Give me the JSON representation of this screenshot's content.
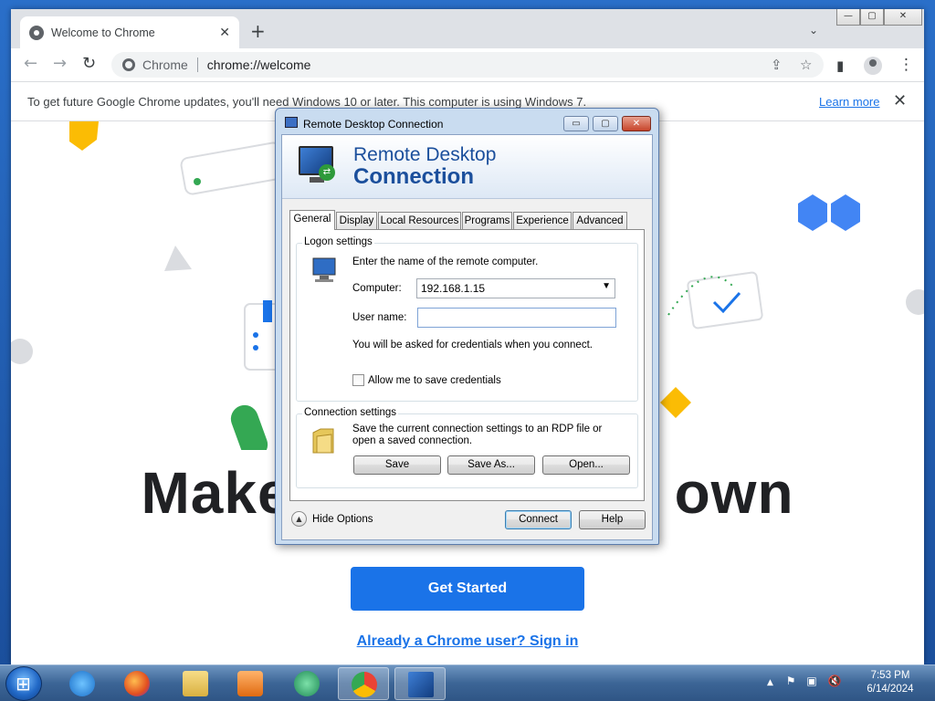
{
  "browser": {
    "tab_title": "Welcome to Chrome",
    "tab_close": "✕",
    "new_tab": "+",
    "tab_search": "⌄",
    "window_controls": [
      "—",
      "▢",
      "✕"
    ],
    "site_label": "Chrome",
    "url": "chrome://welcome",
    "back_icon": "←",
    "forward_icon": "→",
    "reload_icon": "↻",
    "share_icon": "⇪",
    "bookmark_icon": "☆",
    "sidepanel_icon": "▮",
    "menu_icon": "⋮"
  },
  "infobar": {
    "message": "To get future Google Chrome updates, you'll need Windows 10 or later. This computer is using Windows 7.",
    "learn_more": "Learn more",
    "close": "✕"
  },
  "welcome": {
    "headline_left": "Make",
    "headline_right": "own",
    "get_started": "Get Started",
    "sign_in": "Already a Chrome user? Sign in"
  },
  "rdp": {
    "title": "Remote Desktop Connection",
    "banner_line1": "Remote Desktop",
    "banner_line2": "Connection",
    "controls": [
      "▭",
      "▢",
      "✕"
    ],
    "tabs": [
      "General",
      "Display",
      "Local Resources",
      "Programs",
      "Experience",
      "Advanced"
    ],
    "logon_legend": "Logon settings",
    "logon_prompt": "Enter the name of the remote computer.",
    "computer_label": "Computer:",
    "computer_value": "192.168.1.15",
    "username_label": "User name:",
    "username_value": "",
    "credentials_note": "You will be asked for credentials when you connect.",
    "allow_save_label": "Allow me to save credentials",
    "allow_save_checked": false,
    "connection_legend": "Connection settings",
    "connection_text": "Save the current connection settings to an RDP file or open a saved connection.",
    "save_button": "Save",
    "save_as_button": "Save As...",
    "open_button": "Open...",
    "hide_options": "Hide Options",
    "connect_button": "Connect",
    "help_button": "Help"
  },
  "taskbar": {
    "clock_time": "7:53 PM",
    "clock_date": "6/14/2024",
    "tray_icons": [
      "▲",
      "⚑",
      "▣",
      "🔇"
    ]
  },
  "colors": {
    "chrome_blue": "#1a73e8",
    "rdp_banner_text": "#1b4f9c",
    "desktop": "#2a6fc9"
  }
}
